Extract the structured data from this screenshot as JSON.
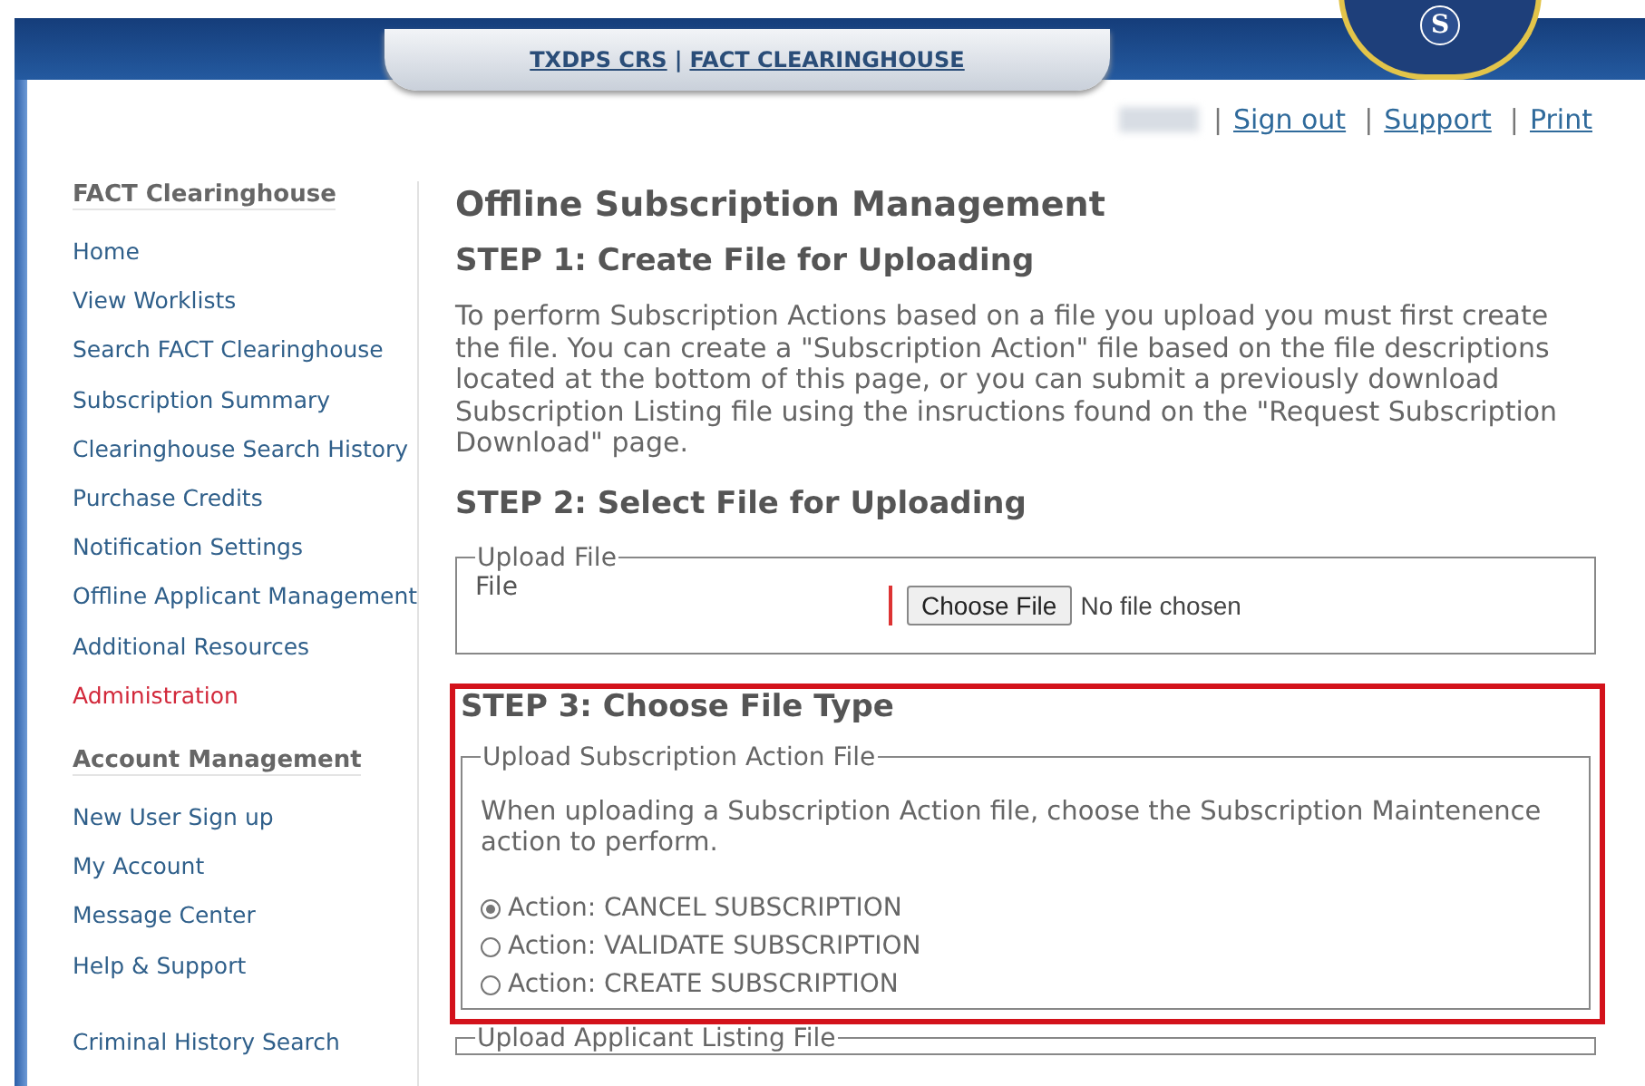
{
  "header": {
    "links": [
      "TXDPS CRS",
      "FACT CLEARINGHOUSE"
    ],
    "separator": "|",
    "seal_letter": "S"
  },
  "top_links": {
    "separator": "|",
    "items": [
      "Sign out",
      "Support",
      "Print"
    ]
  },
  "sidebar": {
    "sections": [
      {
        "heading": "FACT Clearinghouse",
        "items": [
          {
            "label": "Home",
            "kind": "link"
          },
          {
            "label": "View Worklists",
            "kind": "link"
          },
          {
            "label": "Search FACT Clearinghouse",
            "kind": "link"
          },
          {
            "label": "Subscription Summary",
            "kind": "link"
          },
          {
            "label": "Clearinghouse Search History",
            "kind": "link"
          },
          {
            "label": "Purchase Credits",
            "kind": "link"
          },
          {
            "label": "Notification Settings",
            "kind": "link"
          },
          {
            "label": "Offline Applicant Management",
            "kind": "link"
          },
          {
            "label": "Additional Resources",
            "kind": "link"
          },
          {
            "label": "Administration",
            "kind": "alert"
          }
        ]
      },
      {
        "heading": "Account Management",
        "items": [
          {
            "label": "New User Sign up",
            "kind": "link"
          },
          {
            "label": "My Account",
            "kind": "link"
          },
          {
            "label": "Message Center",
            "kind": "link"
          },
          {
            "label": "Help & Support",
            "kind": "link"
          }
        ]
      },
      {
        "items": [
          {
            "label": "Criminal History Search",
            "kind": "link"
          }
        ]
      }
    ]
  },
  "main": {
    "title": "Offline Subscription Management",
    "step1": {
      "heading": "STEP 1: Create File for Uploading",
      "text": "To perform Subscription Actions based on a file you upload you must first create the file. You can create a \"Subscription Action\" file based on the file descriptions located at the bottom of this page, or you can submit a previously download Subscription Listing file using the insructions found on the \"Request Subscription Download\" page."
    },
    "step2": {
      "heading": "STEP 2: Select File for Uploading",
      "fieldset": {
        "legend": "Upload File",
        "label": "File",
        "button": "Choose File",
        "status": "No file chosen"
      }
    },
    "step3": {
      "heading": "STEP 3: Choose File Type",
      "highlighted": true,
      "fieldset": {
        "legend": "Upload Subscription Action File",
        "text": "When uploading a Subscription Action file, choose the Subscription Maintenence action to perform.",
        "options": [
          {
            "label": "Action: CANCEL SUBSCRIPTION",
            "selected": true
          },
          {
            "label": "Action: VALIDATE SUBSCRIPTION",
            "selected": false
          },
          {
            "label": "Action: CREATE SUBSCRIPTION",
            "selected": false
          }
        ]
      }
    },
    "next_fieldset": {
      "legend": "Upload Applicant Listing File"
    }
  }
}
